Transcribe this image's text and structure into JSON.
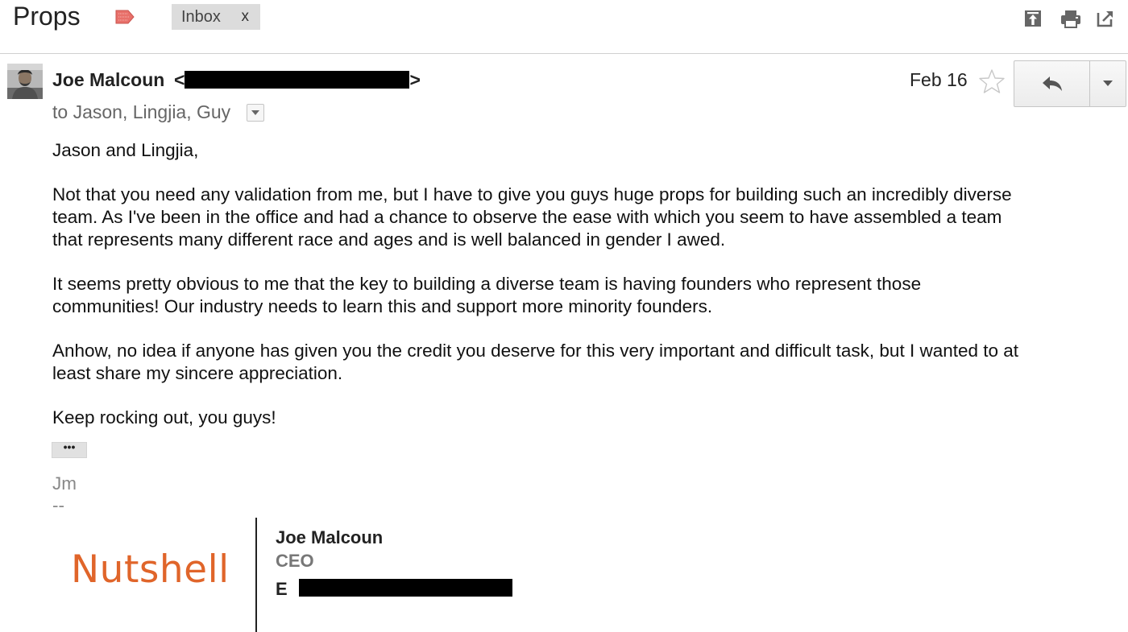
{
  "thread": {
    "subject": "Props",
    "label_chip": "Inbox",
    "label_chip_close": "x"
  },
  "toolbar": {
    "icons": [
      "expand-all-icon",
      "print-icon",
      "new-window-icon"
    ]
  },
  "message": {
    "sender_name": "Joe Malcoun",
    "email_open": "<",
    "email_close": ">",
    "to_line": "to Jason, Lingjia, Guy",
    "date": "Feb 16"
  },
  "body": {
    "greeting": "Jason and Lingjia,",
    "p1_l1": "Not that you need any validation from me, but I have to give you guys huge props for building such an incredibly diverse",
    "p1_l2": "team. As I've been in the office and had a chance to observe the ease with which you seem to have assembled a team",
    "p1_l3": "that represents many different race and ages and is well balanced in gender I awed.",
    "p2_l1": "It seems pretty obvious to me that the key to building a diverse team is having founders who represent those",
    "p2_l2": "communities! Our industry needs to learn this and support more minority founders.",
    "p3_l1": "Anhow, no idea if anyone has given you the credit you deserve for this very important and difficult task, but I wanted to at",
    "p3_l2": "least share my sincere appreciation.",
    "closing": "Keep rocking out, you guys!",
    "trimmed_content": "•••"
  },
  "signature": {
    "initials": "Jm",
    "dash": "--",
    "logo_text": "Nutshell",
    "name": "Joe Malcoun",
    "title": "CEO",
    "email_label": "E"
  },
  "colors": {
    "logo_orange": "#e0652a",
    "label_tag_red": "#e8706a",
    "chip_bg": "#dcdcdc"
  }
}
